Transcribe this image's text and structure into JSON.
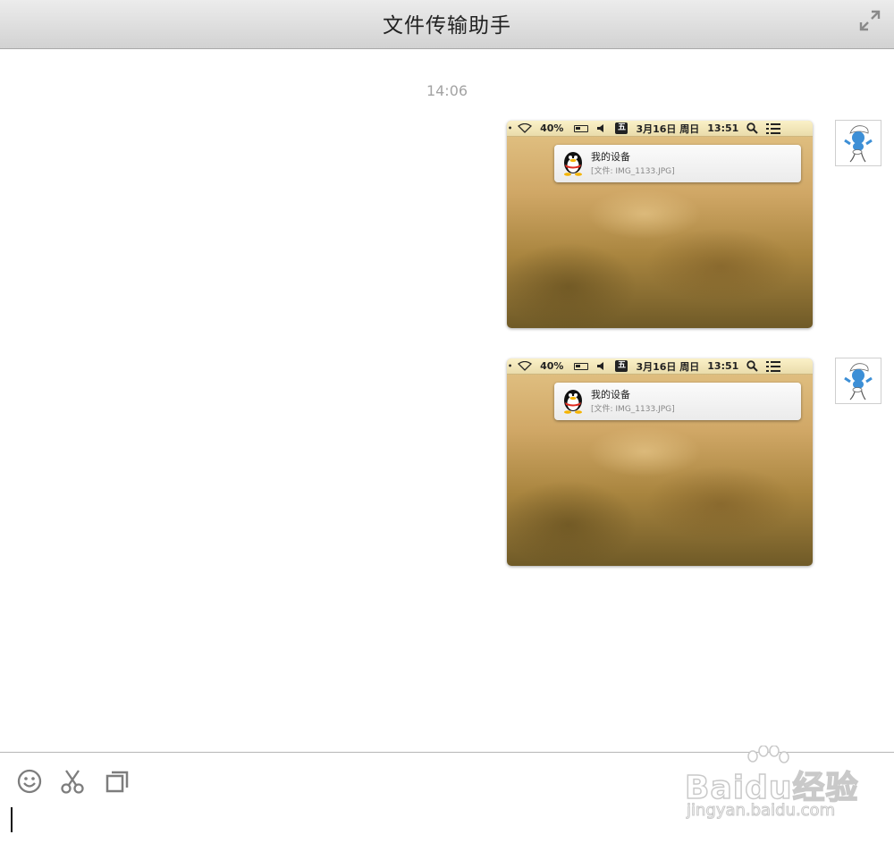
{
  "window": {
    "title": "文件传输助手"
  },
  "chat": {
    "timestamp": "14:06",
    "messages": [
      {
        "menubar": {
          "battery": "40%",
          "date": "3月16日 周日",
          "time": "13:51",
          "ime": "五"
        },
        "notification": {
          "title": "我的设备",
          "subtitle": "[文件: IMG_1133.JPG]"
        }
      },
      {
        "menubar": {
          "battery": "40%",
          "date": "3月16日 周日",
          "time": "13:51",
          "ime": "五"
        },
        "notification": {
          "title": "我的设备",
          "subtitle": "[文件: IMG_1133.JPG]"
        }
      }
    ]
  },
  "toolbar": {
    "icons": [
      "emoji-icon",
      "scissors-icon",
      "window-icon"
    ]
  },
  "watermark": {
    "main": "Baidu经验",
    "sub": "jingyan.baidu.com"
  },
  "colors": {
    "titlebar": "#dcdcdc",
    "timestamp": "#a3a3a3",
    "avatar_blue": "#3d8fd6"
  }
}
